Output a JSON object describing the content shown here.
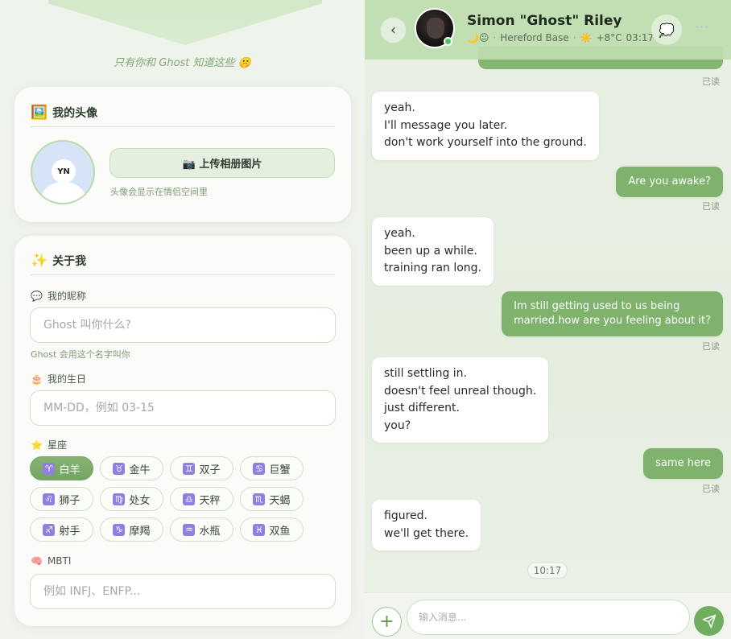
{
  "profile": {
    "secret_line": "只有你和 Ghost 知道这些 🤫",
    "avatar_section": {
      "title_emoji": "🖼️",
      "title": "我的头像",
      "avatar_initials": "YN",
      "upload_label": "📷 上传相册图片",
      "upload_hint": "头像会显示在情侣空间里"
    },
    "about_section": {
      "title_emoji": "✨",
      "title": "关于我",
      "nickname": {
        "icon": "💬",
        "label": "我的昵称",
        "placeholder": "Ghost 叫你什么?",
        "hint": "Ghost 会用这个名字叫你"
      },
      "birthday": {
        "icon": "🎂",
        "label": "我的生日",
        "placeholder": "MM-DD，例如 03-15"
      },
      "zodiac": {
        "icon": "⭐",
        "label": "星座",
        "selected": "白羊",
        "options": [
          {
            "symbol": "♈",
            "name": "白羊"
          },
          {
            "symbol": "♉",
            "name": "金牛"
          },
          {
            "symbol": "♊",
            "name": "双子"
          },
          {
            "symbol": "♋",
            "name": "巨蟹"
          },
          {
            "symbol": "♌",
            "name": "狮子"
          },
          {
            "symbol": "♍",
            "name": "处女"
          },
          {
            "symbol": "♎",
            "name": "天秤"
          },
          {
            "symbol": "♏",
            "name": "天蝎"
          },
          {
            "symbol": "♐",
            "name": "射手"
          },
          {
            "symbol": "♑",
            "name": "摩羯"
          },
          {
            "symbol": "♒",
            "name": "水瓶"
          },
          {
            "symbol": "♓",
            "name": "双鱼"
          }
        ]
      },
      "mbti": {
        "icon": "🧠",
        "label": "MBTI",
        "placeholder": "例如 INFJ、ENFP..."
      }
    }
  },
  "chat": {
    "contact_name": "Simon \"Ghost\" Riley",
    "status_emojis": "🌙😐",
    "location": "Hereford Base",
    "weather_icon": "☀️",
    "weather": "+8°C",
    "time": "03:17",
    "more_icon": "···",
    "read_label": "已读",
    "messages": [
      {
        "from": "ghost",
        "text": "yeah.\nI'll message you later.\ndon't work yourself into the ground."
      },
      {
        "from": "me",
        "text": "Are you awake?"
      },
      {
        "from": "ghost",
        "text": "yeah.\nbeen up a while.\ntraining ran long."
      },
      {
        "from": "me",
        "text": "Im still getting used to us being\nmarried.how are you feeling about it?"
      },
      {
        "from": "ghost",
        "text": "still settling in.\ndoesn't feel unreal though.\njust different.\nyou?"
      },
      {
        "from": "me",
        "text": "same here"
      },
      {
        "from": "ghost",
        "text": "figured.\nwe'll get there."
      }
    ],
    "timestamp": "10:17",
    "composer_placeholder": "输入消息...",
    "plus_label": "+"
  }
}
